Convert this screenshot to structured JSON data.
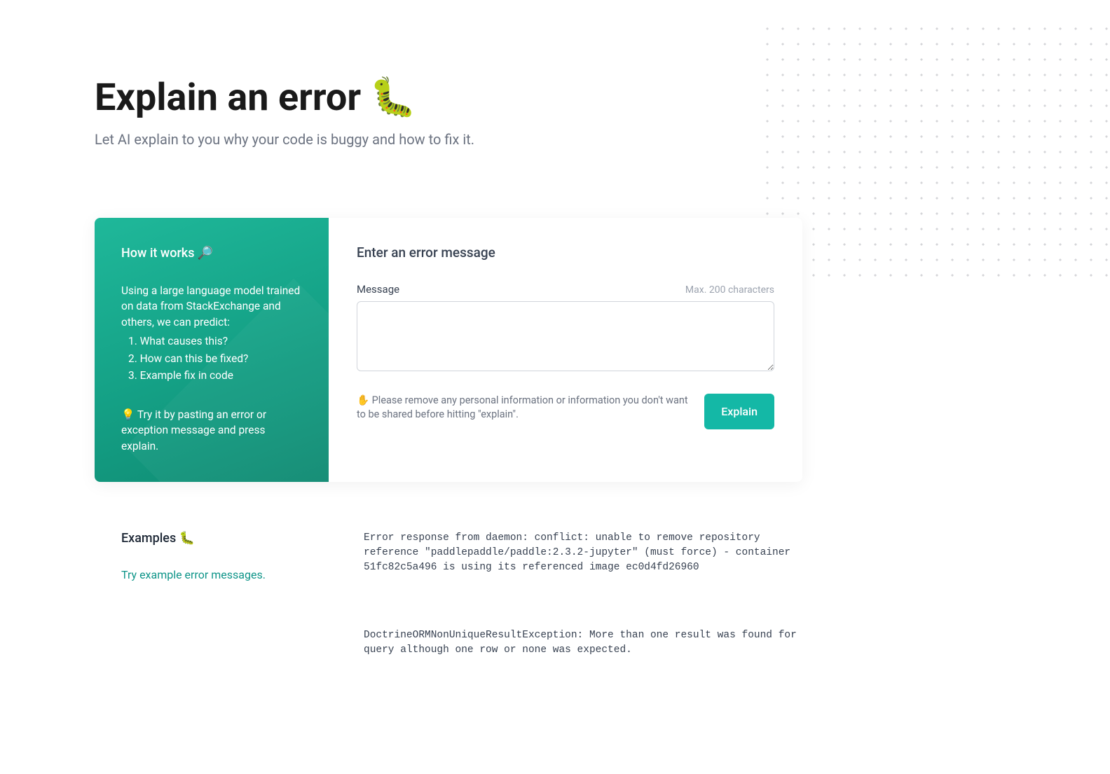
{
  "header": {
    "title": "Explain an error",
    "title_emoji": "🐛",
    "subtitle": "Let AI explain to you why your code is buggy and how to fix it."
  },
  "sidebar": {
    "title": "How it works 🔎",
    "description": "Using a large language model trained on data from StackExchange and others, we can predict:",
    "items": [
      "1. What causes this?",
      "2. How can this be fixed?",
      "3. Example fix in code"
    ],
    "try_text": "💡 Try it by pasting an error or exception message and press explain."
  },
  "form": {
    "heading": "Enter an error message",
    "message_label": "Message",
    "char_limit": "Max. 200 characters",
    "textarea_value": "",
    "privacy_note": "✋ Please remove any personal information or information you don't want to be shared before hitting \"explain\".",
    "button_label": "Explain"
  },
  "examples": {
    "title": "Examples 🐛",
    "description": "Try example error messages.",
    "items": [
      "Error response from daemon: conflict: unable to remove repository reference \"paddlepaddle/paddle:2.3.2-jupyter\" (must force) - container 51fc82c5a496 is using its referenced image ec0d4fd26960",
      "DoctrineORMNonUniqueResultException: More than one result was found for query although one row or none was expected."
    ]
  }
}
